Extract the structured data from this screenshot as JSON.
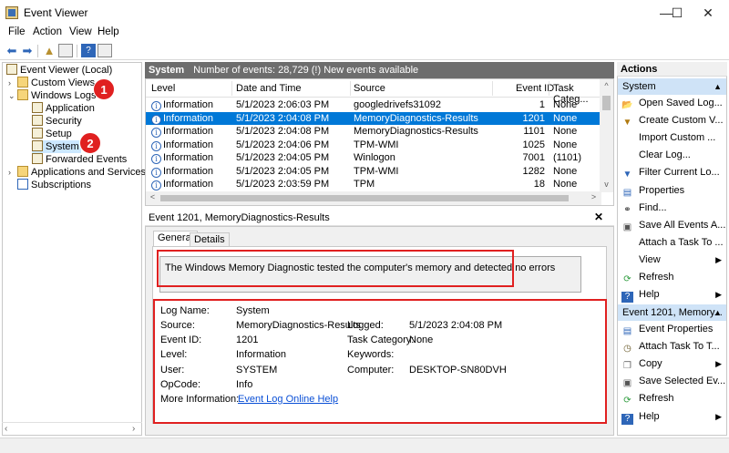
{
  "window": {
    "title": "Event Viewer",
    "minimize": "—",
    "maximize": "☐",
    "close": "✕"
  },
  "menu": [
    "File",
    "Action",
    "View",
    "Help"
  ],
  "tree": {
    "root": "Event Viewer (Local)",
    "custom_views": "Custom Views",
    "windows_logs": "Windows Logs",
    "application": "Application",
    "security": "Security",
    "setup": "Setup",
    "system": "System",
    "forwarded": "Forwarded Events",
    "apps_services": "Applications and Services Lo",
    "subscriptions": "Subscriptions"
  },
  "badges": {
    "one": "1",
    "two": "2"
  },
  "log_header": {
    "name": "System",
    "summary": "Number of events: 28,729 (!) New events available"
  },
  "grid": {
    "columns": [
      "Level",
      "Date and Time",
      "Source",
      "Event ID",
      "Task Categ..."
    ],
    "rows": [
      {
        "level": "Information",
        "date": "5/1/2023 2:06:03 PM",
        "source": "googledrivefs31092",
        "id": "1",
        "task": "None"
      },
      {
        "level": "Information",
        "date": "5/1/2023 2:04:08 PM",
        "source": "MemoryDiagnostics-Results",
        "id": "1201",
        "task": "None"
      },
      {
        "level": "Information",
        "date": "5/1/2023 2:04:08 PM",
        "source": "MemoryDiagnostics-Results",
        "id": "1101",
        "task": "None"
      },
      {
        "level": "Information",
        "date": "5/1/2023 2:04:06 PM",
        "source": "TPM-WMI",
        "id": "1025",
        "task": "None"
      },
      {
        "level": "Information",
        "date": "5/1/2023 2:04:05 PM",
        "source": "Winlogon",
        "id": "7001",
        "task": "(1101)"
      },
      {
        "level": "Information",
        "date": "5/1/2023 2:04:05 PM",
        "source": "TPM-WMI",
        "id": "1282",
        "task": "None"
      },
      {
        "level": "Information",
        "date": "5/1/2023 2:03:59 PM",
        "source": "TPM",
        "id": "18",
        "task": "None"
      }
    ]
  },
  "detail": {
    "title": "Event 1201, MemoryDiagnostics-Results",
    "close": "✕",
    "tabs": [
      "General",
      "Details"
    ],
    "message": "The Windows Memory Diagnostic tested the computer's memory and detected no errors",
    "fields": {
      "log_name_label": "Log Name:",
      "log_name": "System",
      "source_label": "Source:",
      "source": "MemoryDiagnostics-Results",
      "logged_label": "Logged:",
      "logged": "5/1/2023 2:04:08 PM",
      "event_id_label": "Event ID:",
      "event_id": "1201",
      "task_label": "Task Category:",
      "task": "None",
      "level_label": "Level:",
      "level": "Information",
      "keywords_label": "Keywords:",
      "keywords": "",
      "user_label": "User:",
      "user": "SYSTEM",
      "computer_label": "Computer:",
      "computer": "DESKTOP-SN80DVH",
      "opcode_label": "OpCode:",
      "opcode": "Info",
      "more_info_label": "More Information:",
      "more_info_link": "Event Log Online Help"
    }
  },
  "actions": {
    "title": "Actions",
    "section1": "System",
    "items1": [
      "Open Saved Log...",
      "Create Custom V...",
      "Import Custom ...",
      "Clear Log...",
      "Filter Current Lo...",
      "Properties",
      "Find...",
      "Save All Events A...",
      "Attach a Task To ...",
      "View",
      "Refresh",
      "Help"
    ],
    "section2": "Event 1201, Memory...",
    "items2": [
      "Event Properties",
      "Attach Task To T...",
      "Copy",
      "Save Selected Ev...",
      "Refresh",
      "Help"
    ]
  },
  "colors": {
    "selection": "#0078d7",
    "accent_red": "#e02020",
    "section_bg": "#cfe3f7"
  }
}
